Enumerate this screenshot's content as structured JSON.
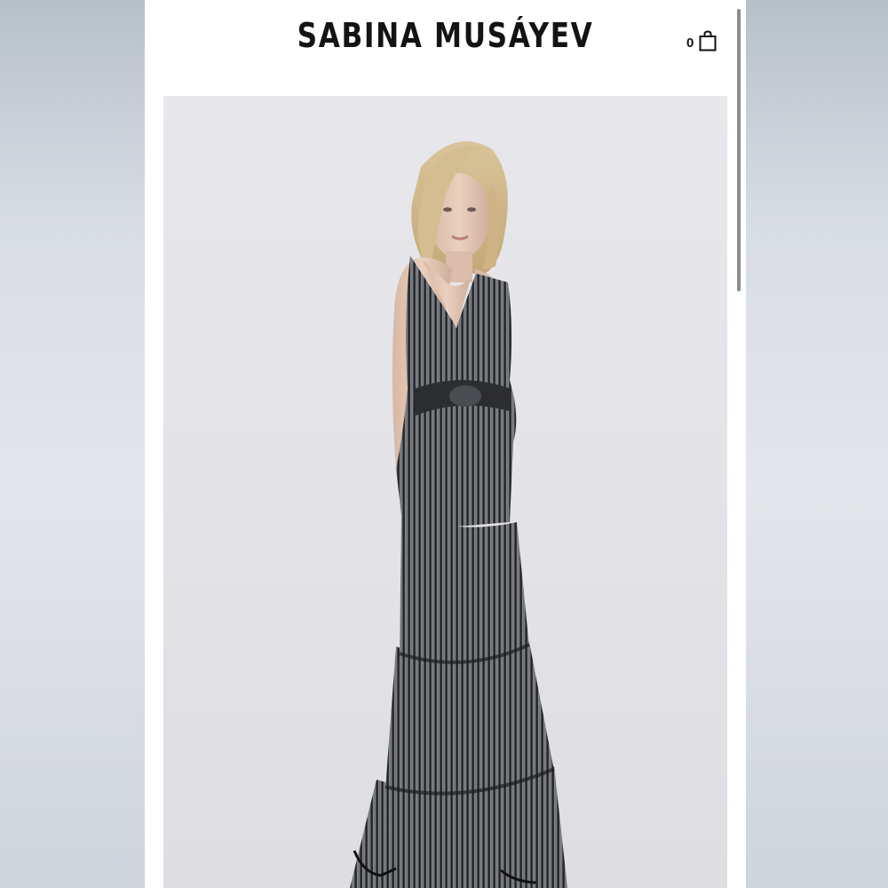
{
  "header": {
    "brand": "SABINA MUSÁYEV",
    "cart": {
      "count": "0",
      "icon": "shopping-bag-icon"
    }
  },
  "product": {
    "image": "model-in-tiered-metallic-maxi-dress"
  },
  "colors": {
    "brand_text": "#141414",
    "page_bg": "#ffffff",
    "photo_bg": "#e5e5ea",
    "dress": "#3a3b3f",
    "scrollbar": "#8c8c8c"
  }
}
